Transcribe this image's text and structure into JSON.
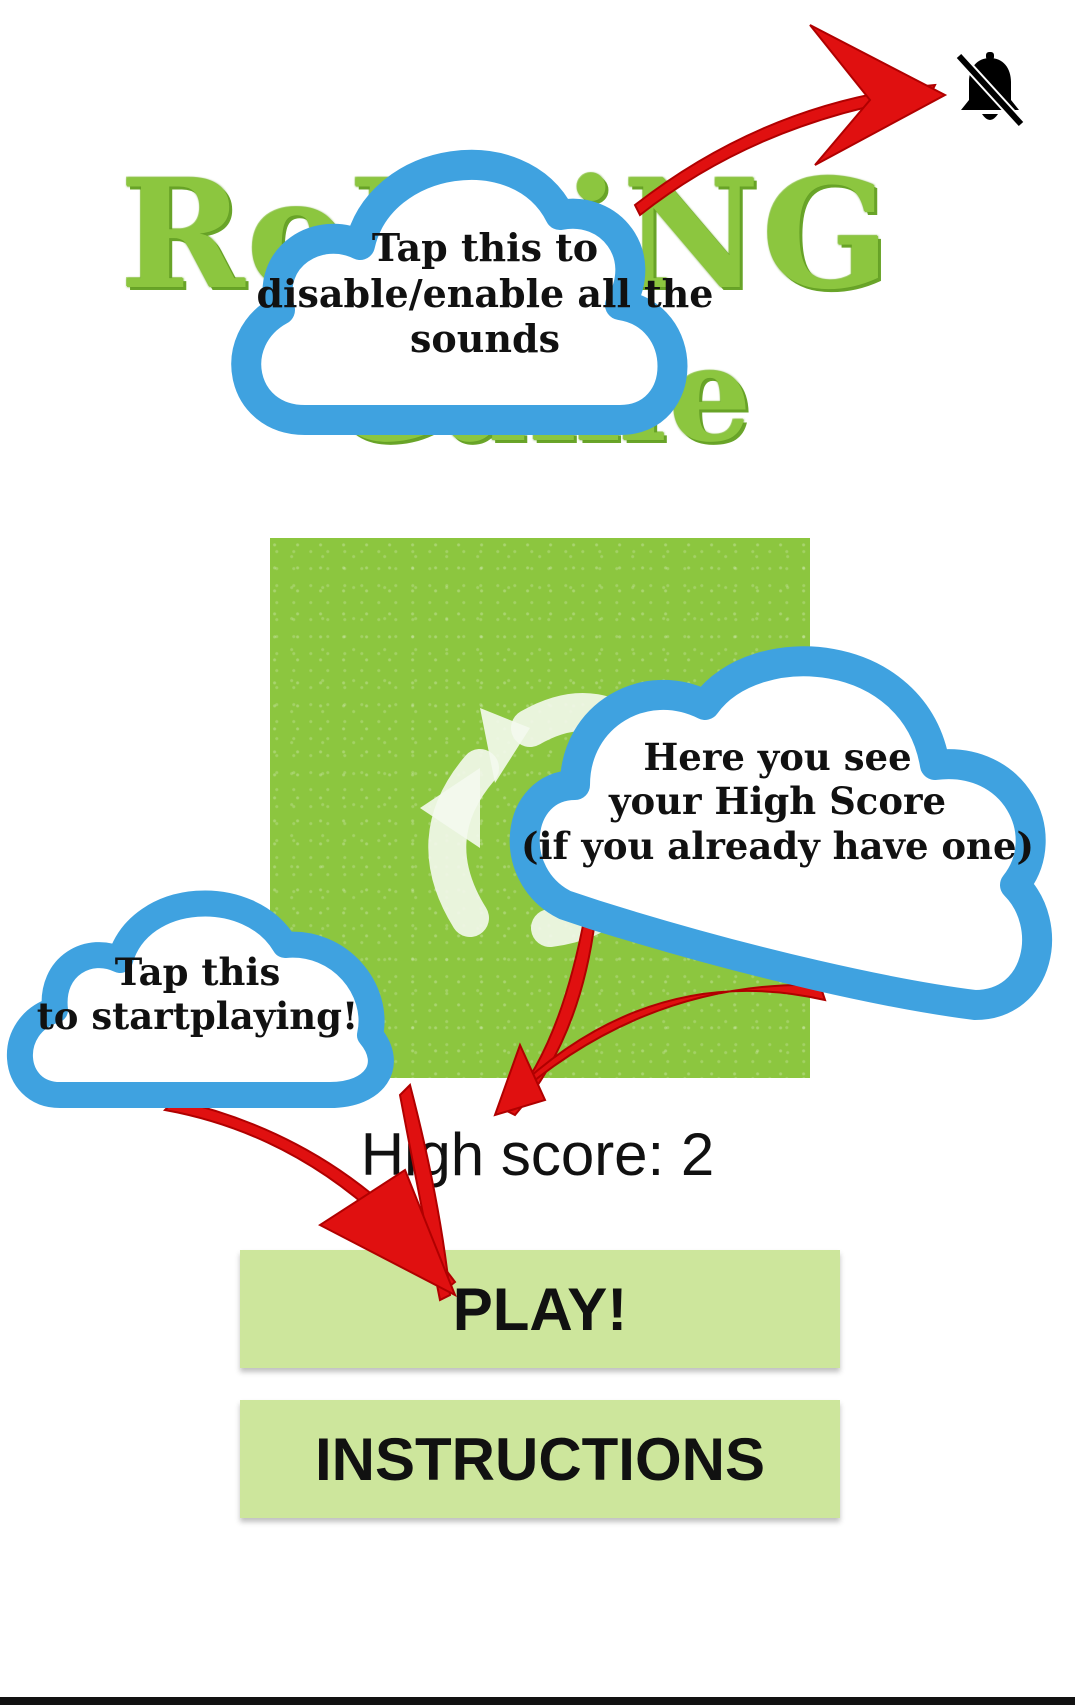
{
  "logo": {
    "line1": "RoLLiNG",
    "line2": "Game"
  },
  "sound_toggle": {
    "icon": "bell-off-icon",
    "state": "muted"
  },
  "high_score": {
    "text": "High score: 2"
  },
  "buttons": {
    "play": "PLAY!",
    "instructions": "INSTRUCTIONS"
  },
  "tutorial": {
    "sound_bubble": {
      "line1": "Tap this  to",
      "line2": "disable/enable all the",
      "line3": "sounds"
    },
    "score_bubble": {
      "line1": "Here you see",
      "line2": "your High Score",
      "line3": "(if you already have one)"
    },
    "play_bubble": {
      "line1": "Tap this",
      "line2": "to startplaying!"
    }
  },
  "colors": {
    "accent_green": "#8cc63f",
    "button_green": "#cde69c",
    "cloud_blue": "#3fa2e0",
    "arrow_red": "#e01010"
  }
}
